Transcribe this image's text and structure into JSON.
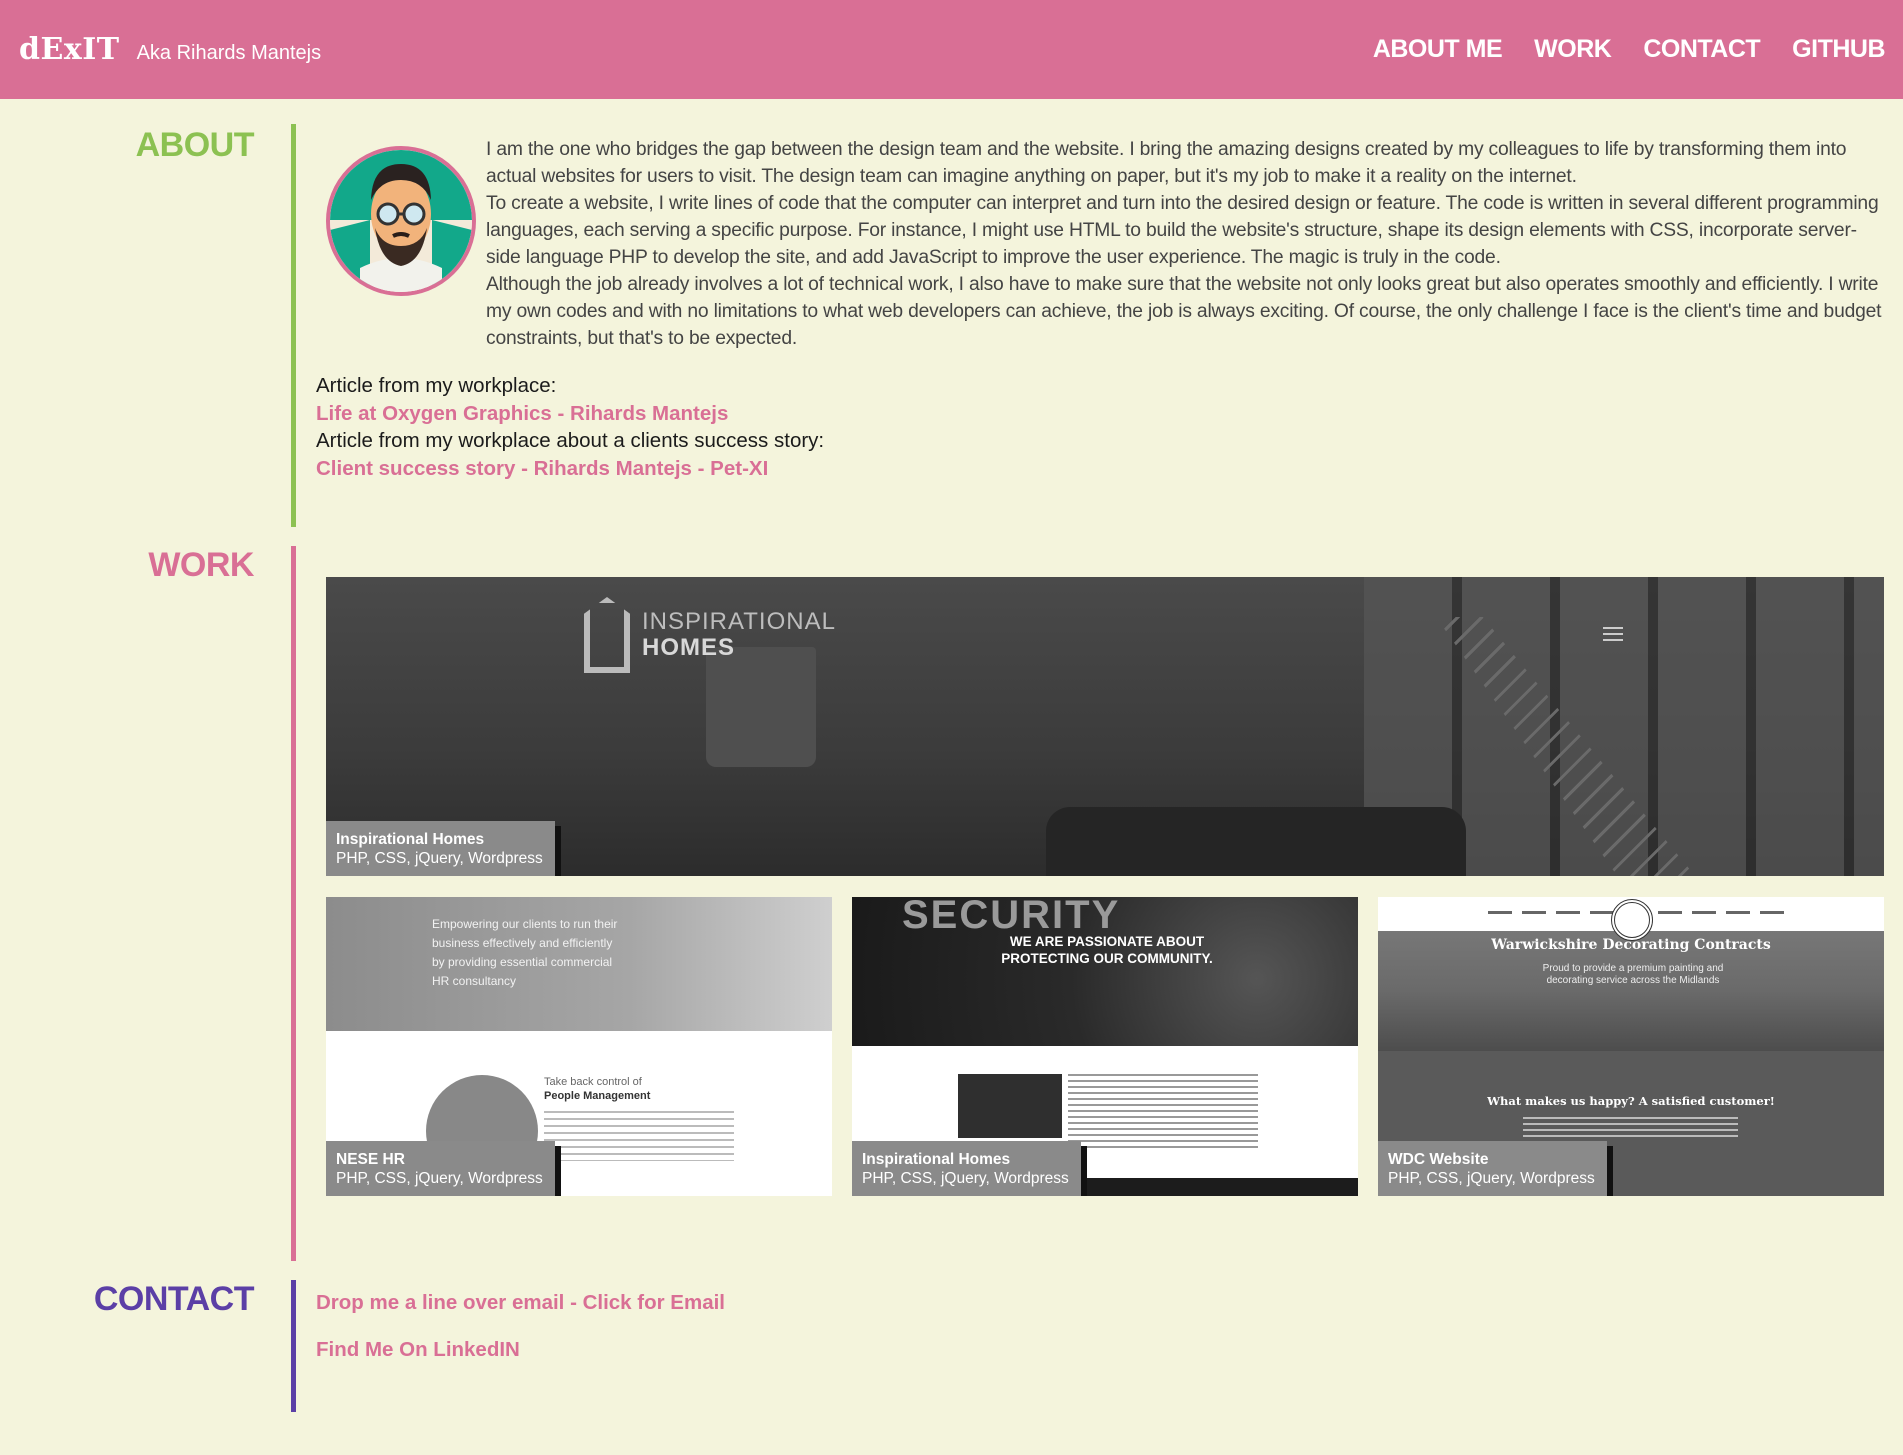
{
  "header": {
    "logo": "dExIT",
    "tagline": "Aka Rihards Mantejs",
    "nav": [
      "ABOUT ME",
      "WORK",
      "CONTACT",
      "GITHUB"
    ]
  },
  "about": {
    "title": "ABOUT",
    "paragraphs": [
      "I am the one who bridges the gap between the design team and the website. I bring the amazing designs created by my colleagues to life by transforming them into actual websites for users to visit. The design team can imagine anything on paper, but it's my job to make it a reality on the internet.",
      "To create a website, I write lines of code that the computer can interpret and turn into the desired design or feature. The code is written in several different programming languages, each serving a specific purpose. For instance, I might use HTML to build the website's structure, shape its design elements with CSS, incorporate server-side language PHP to develop the site, and add JavaScript to improve the user experience. The magic is truly in the code.",
      "Although the job already involves a lot of technical work, I also have to make sure that the website not only looks great but also operates smoothly and efficiently. I write my own codes and with no limitations to what web developers can achieve, the job is always exciting. Of course, the only challenge I face is the client's time and budget constraints, but that's to be expected."
    ],
    "article1_label": "Article from my workplace:",
    "article1_link": "Life at Oxygen Graphics - Rihards Mantejs",
    "article2_label": "Article from my workplace about a clients success story:",
    "article2_link": "Client success story - Rihards Mantejs - Pet-XI"
  },
  "work": {
    "title": "WORK",
    "hero": {
      "logo_line1": "INSPIRATIONAL",
      "logo_line2": "HOMES",
      "caption_title": "Inspirational Homes",
      "caption_stack": "PHP, CSS, jQuery, Wordpress"
    },
    "cards": [
      {
        "caption_title": "NESE HR",
        "caption_stack": "PHP, CSS, jQuery, Wordpress",
        "banner_text": "Empowering our clients to run their business effectively and efficiently by providing essential commercial HR consultancy",
        "sub_heading": "Take back control of",
        "sub_heading_bold": "People Management"
      },
      {
        "caption_title": "Inspirational Homes",
        "caption_stack": "PHP, CSS, jQuery, Wordpress",
        "banner_big": "SECURITY",
        "banner_text": "WE ARE PASSIONATE ABOUT PROTECTING OUR COMMUNITY."
      },
      {
        "caption_title": "WDC Website",
        "caption_stack": "PHP, CSS, jQuery, Wordpress",
        "banner_title": "Warwickshire Decorating Contracts",
        "banner_text": "Proud to provide a premium painting and decorating service across the Midlands",
        "question": "What makes us happy? A satisfied customer!"
      }
    ]
  },
  "contact": {
    "title": "CONTACT",
    "email_link": "Drop me a line over email - Click for Email",
    "linkedin_link": "Find Me On LinkedIN"
  },
  "colors": {
    "header": "#d96f95",
    "background": "#f4f4dc",
    "about_accent": "#8cc152",
    "work_accent": "#d96f95",
    "contact_accent": "#5b3fa6"
  }
}
